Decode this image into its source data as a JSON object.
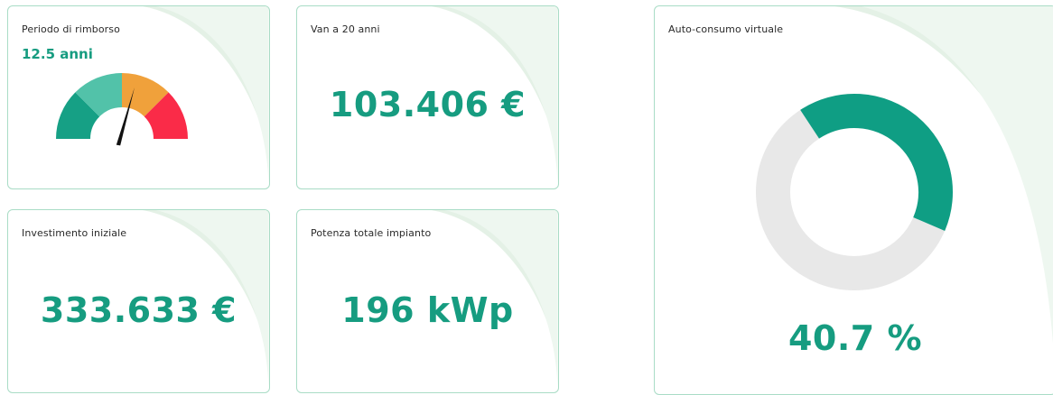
{
  "cards": {
    "payback": {
      "title": "Periodo di rimborso",
      "value": "12.5 anni"
    },
    "npv": {
      "title": "Van a 20 anni",
      "value": "103.406 €"
    },
    "investment": {
      "title": "Investimento iniziale",
      "value": "333.633 €"
    },
    "power": {
      "title": "Potenza totale impianto",
      "value": "196 kWp"
    },
    "selfconsumption": {
      "title": "Auto-consumo virtuale",
      "value": "40.7 %",
      "fraction": 0.407
    }
  },
  "gauge": {
    "segments": [
      {
        "color": "#16a085"
      },
      {
        "color": "#52c2a9"
      },
      {
        "color": "#f0a13b"
      },
      {
        "color": "#fa2b48"
      }
    ],
    "needle_fraction": 0.55
  },
  "colors": {
    "accent": "#169c80",
    "donut_fill": "#0f9e84",
    "donut_track": "#e8e8e8",
    "card_border": "#a9dcc6",
    "card_decor": "#e4f1e6"
  }
}
